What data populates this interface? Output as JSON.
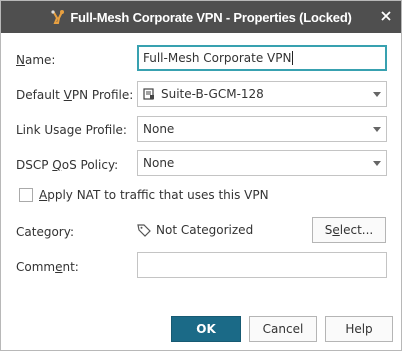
{
  "title": "Full-Mesh Corporate VPN - Properties (Locked)",
  "colors": {
    "titlebar": "#4f4f4f",
    "focus": "#38a1b0",
    "primary": "#1b6a87"
  },
  "fields": {
    "name": {
      "label_pre": "",
      "label_u": "N",
      "label_post": "ame:",
      "value": "Full-Mesh Corporate VPN"
    },
    "vpn_profile": {
      "label_pre": "Default ",
      "label_u": "V",
      "label_post": "PN Profile:",
      "value": "Suite-B-GCM-128",
      "icon": "vpn-profile-icon"
    },
    "link_usage": {
      "label_pre": "Link Usage Profile:",
      "label_u": "",
      "label_post": "",
      "value": "None"
    },
    "dscp": {
      "label_pre": "DSCP ",
      "label_u": "Q",
      "label_post": "oS Policy:",
      "value": "None"
    }
  },
  "nat_checkbox": {
    "label_pre": "",
    "label_u": "A",
    "label_post": "pply NAT to traffic that uses this VPN",
    "checked": false
  },
  "category": {
    "label": "Category:",
    "value": "Not Categorized",
    "icon": "tag-icon",
    "select_pre": "S",
    "select_u": "e",
    "select_post": "lect..."
  },
  "comment": {
    "label_pre": "Comm",
    "label_u": "e",
    "label_post": "nt:",
    "value": ""
  },
  "buttons": {
    "ok": "OK",
    "cancel": "Cancel",
    "help": "Help"
  }
}
